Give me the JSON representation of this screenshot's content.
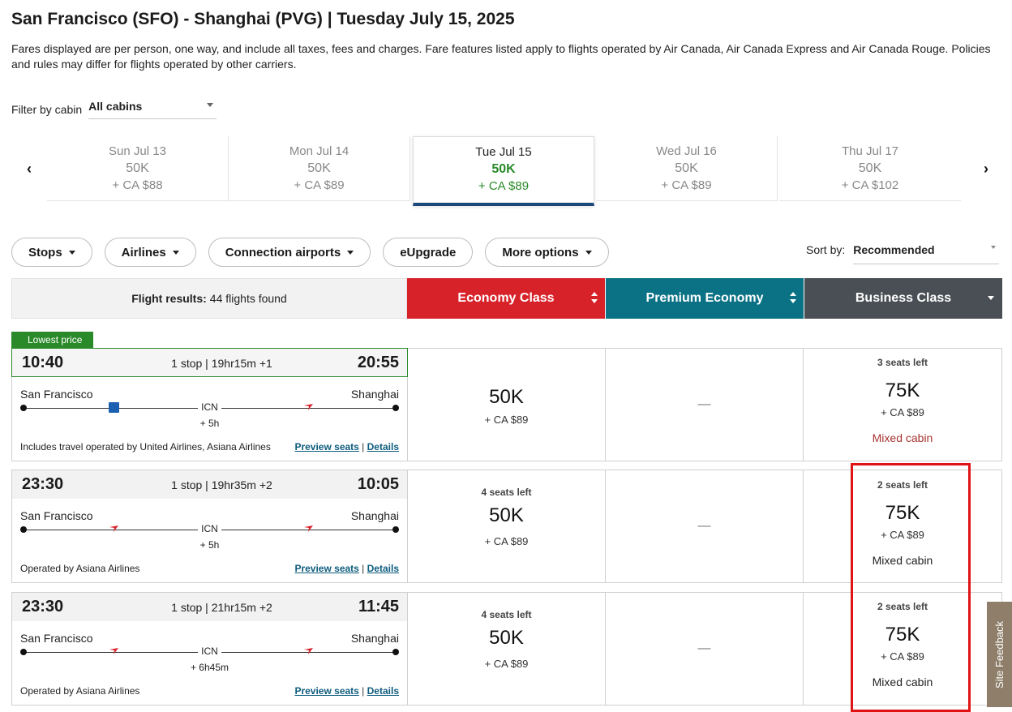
{
  "header": {
    "title": "San Francisco (SFO) - Shanghai (PVG)  |  Tuesday July 15, 2025",
    "disclaimer": "Fares displayed are per person, one way, and include all taxes, fees and charges. Fare features listed apply to flights operated by Air Canada, Air Canada Express and Air Canada Rouge. Policies and rules may differ for flights operated by other carriers."
  },
  "cabin_filter": {
    "label": "Filter by cabin",
    "value": "All cabins"
  },
  "dates": [
    {
      "day": "Sun Jul 13",
      "points": "50K",
      "cash": "+ CA $88",
      "active": false
    },
    {
      "day": "Mon Jul 14",
      "points": "50K",
      "cash": "+ CA $89",
      "active": false
    },
    {
      "day": "Tue Jul 15",
      "points": "50K",
      "cash": "+ CA $89",
      "active": true
    },
    {
      "day": "Wed Jul 16",
      "points": "50K",
      "cash": "+ CA $89",
      "active": false
    },
    {
      "day": "Thu Jul 17",
      "points": "50K",
      "cash": "+ CA $102",
      "active": false
    }
  ],
  "filters": {
    "stops": "Stops",
    "airlines": "Airlines",
    "connection": "Connection airports",
    "eupgrade": "eUpgrade",
    "more": "More options"
  },
  "sort": {
    "label": "Sort by:",
    "value": "Recommended"
  },
  "table_header": {
    "results_label": "Flight results:",
    "results_count": "44 flights found",
    "economy": "Economy Class",
    "premium": "Premium Economy",
    "business": "Business Class"
  },
  "badge": "Lowest price",
  "flights": [
    {
      "depart": "10:40",
      "arrive": "20:55",
      "summary": "1 stop | 19hr15m +1",
      "from": "San Francisco",
      "to": "Shanghai",
      "hub": "ICN",
      "layover": "+ 5h",
      "operated": "Includes travel operated by United Airlines, Asiana Airlines",
      "preview": "Preview seats",
      "details": "Details",
      "economy": {
        "seats": "",
        "points": "50K",
        "cash": "+ CA $89"
      },
      "premium": "—",
      "business": {
        "seats": "3 seats left",
        "points": "75K",
        "cash": "+ CA $89",
        "note": "Mixed cabin"
      }
    },
    {
      "depart": "23:30",
      "arrive": "10:05",
      "summary": "1 stop | 19hr35m +2",
      "from": "San Francisco",
      "to": "Shanghai",
      "hub": "ICN",
      "layover": "+ 5h",
      "operated": "Operated by Asiana Airlines",
      "preview": "Preview seats",
      "details": "Details",
      "economy": {
        "seats": "4 seats left",
        "points": "50K",
        "cash": "+ CA $89"
      },
      "premium": "—",
      "business": {
        "seats": "2 seats left",
        "points": "75K",
        "cash": "+ CA $89",
        "note": "Mixed cabin"
      }
    },
    {
      "depart": "23:30",
      "arrive": "11:45",
      "summary": "1 stop | 21hr15m +2",
      "from": "San Francisco",
      "to": "Shanghai",
      "hub": "ICN",
      "layover": "+ 6h45m",
      "operated": "Operated by Asiana Airlines",
      "preview": "Preview seats",
      "details": "Details",
      "economy": {
        "seats": "4 seats left",
        "points": "50K",
        "cash": "+ CA $89"
      },
      "premium": "—",
      "business": {
        "seats": "2 seats left",
        "points": "75K",
        "cash": "+ CA $89",
        "note": "Mixed cabin"
      }
    }
  ],
  "feedback": "Site Feedback",
  "colors": {
    "economy": "#d8222a",
    "premium": "#0b7285",
    "business": "#4a4f55",
    "lowest": "#2a8a2a",
    "highlight": "#e01414"
  },
  "icons": {
    "asiana": "asiana-airlines-logo-icon",
    "united": "united-airlines-logo-icon"
  }
}
